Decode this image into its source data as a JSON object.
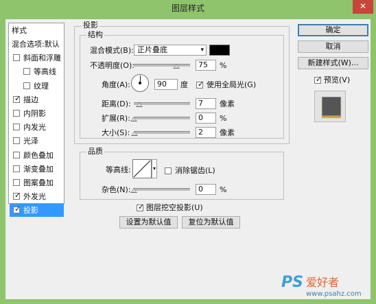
{
  "window": {
    "title": "图层样式",
    "close_glyph": "✕"
  },
  "sidebar": {
    "header": "样式",
    "items": [
      {
        "label": "混合选项:默认",
        "checkbox": false,
        "checked": false,
        "indent": false,
        "selected": false
      },
      {
        "label": "斜面和浮雕",
        "checkbox": true,
        "checked": false,
        "indent": false,
        "selected": false
      },
      {
        "label": "等高线",
        "checkbox": true,
        "checked": false,
        "indent": true,
        "selected": false
      },
      {
        "label": "纹理",
        "checkbox": true,
        "checked": false,
        "indent": true,
        "selected": false
      },
      {
        "label": "描边",
        "checkbox": true,
        "checked": true,
        "indent": false,
        "selected": false
      },
      {
        "label": "内阴影",
        "checkbox": true,
        "checked": false,
        "indent": false,
        "selected": false
      },
      {
        "label": "内发光",
        "checkbox": true,
        "checked": false,
        "indent": false,
        "selected": false
      },
      {
        "label": "光泽",
        "checkbox": true,
        "checked": false,
        "indent": false,
        "selected": false
      },
      {
        "label": "颜色叠加",
        "checkbox": true,
        "checked": false,
        "indent": false,
        "selected": false
      },
      {
        "label": "渐变叠加",
        "checkbox": true,
        "checked": false,
        "indent": false,
        "selected": false
      },
      {
        "label": "图案叠加",
        "checkbox": true,
        "checked": false,
        "indent": false,
        "selected": false
      },
      {
        "label": "外发光",
        "checkbox": true,
        "checked": true,
        "indent": false,
        "selected": false
      },
      {
        "label": "投影",
        "checkbox": true,
        "checked": true,
        "indent": false,
        "selected": true
      }
    ]
  },
  "shadow": {
    "section_title": "投影",
    "structure_title": "结构",
    "blend_mode_label": "混合模式(B):",
    "blend_mode_value": "正片叠底",
    "shadow_color": "#000000",
    "opacity_label": "不透明度(O):",
    "opacity_value": "75",
    "opacity_unit": "%",
    "opacity_level": 0.75,
    "angle_label": "角度(A):",
    "angle_value": "90",
    "angle_unit": "度",
    "global_light_label": "使用全局光(G)",
    "global_light_checked": true,
    "distance_label": "距离(D):",
    "distance_value": "7",
    "distance_unit": "像素",
    "spread_label": "扩展(R):",
    "spread_value": "0",
    "spread_unit": "%",
    "size_label": "大小(S):",
    "size_value": "2",
    "size_unit": "像素"
  },
  "quality": {
    "title": "品质",
    "contour_label": "等高线:",
    "antialias_label": "消除锯齿(L)",
    "antialias_checked": false,
    "noise_label": "杂色(N):",
    "noise_value": "0",
    "noise_unit": "%"
  },
  "knockout": {
    "label": "图层挖空投影(U)",
    "checked": true
  },
  "defaults": {
    "make_default": "设置为默认值",
    "reset_default": "复位为默认值"
  },
  "buttons": {
    "ok": "确定",
    "cancel": "取消",
    "new_style": "新建样式(W)...",
    "preview_label": "预览(V)",
    "preview_checked": true
  },
  "watermark": {
    "brand": "PS",
    "brand_cn": "爱好者",
    "url": "www.psahz.com"
  }
}
